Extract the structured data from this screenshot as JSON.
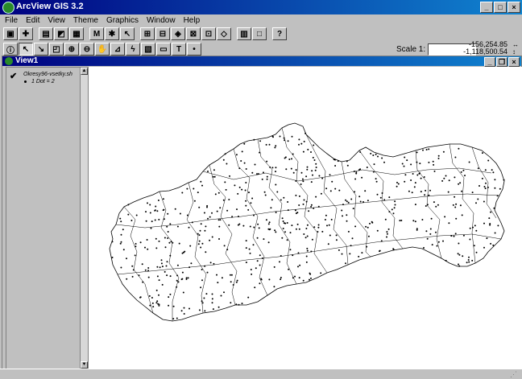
{
  "app": {
    "title": "ArcView GIS 3.2"
  },
  "menu": {
    "items": [
      {
        "label": "File"
      },
      {
        "label": "Edit"
      },
      {
        "label": "View"
      },
      {
        "label": "Theme"
      },
      {
        "label": "Graphics"
      },
      {
        "label": "Window"
      },
      {
        "label": "Help"
      }
    ]
  },
  "toolbar": {
    "scale_label": "Scale 1:",
    "coord_x": "-156,254.85",
    "coord_y": "-1,118,500.54"
  },
  "view": {
    "title": "View1",
    "theme": {
      "name": "Okresy96-vsetky.sh",
      "visible": true,
      "legend_label": "1 Dot = 2"
    }
  },
  "colors": {
    "titlebar_start": "#000080",
    "titlebar_end": "#1084d0",
    "map_background": "#ffffff",
    "outline": "#000000"
  }
}
